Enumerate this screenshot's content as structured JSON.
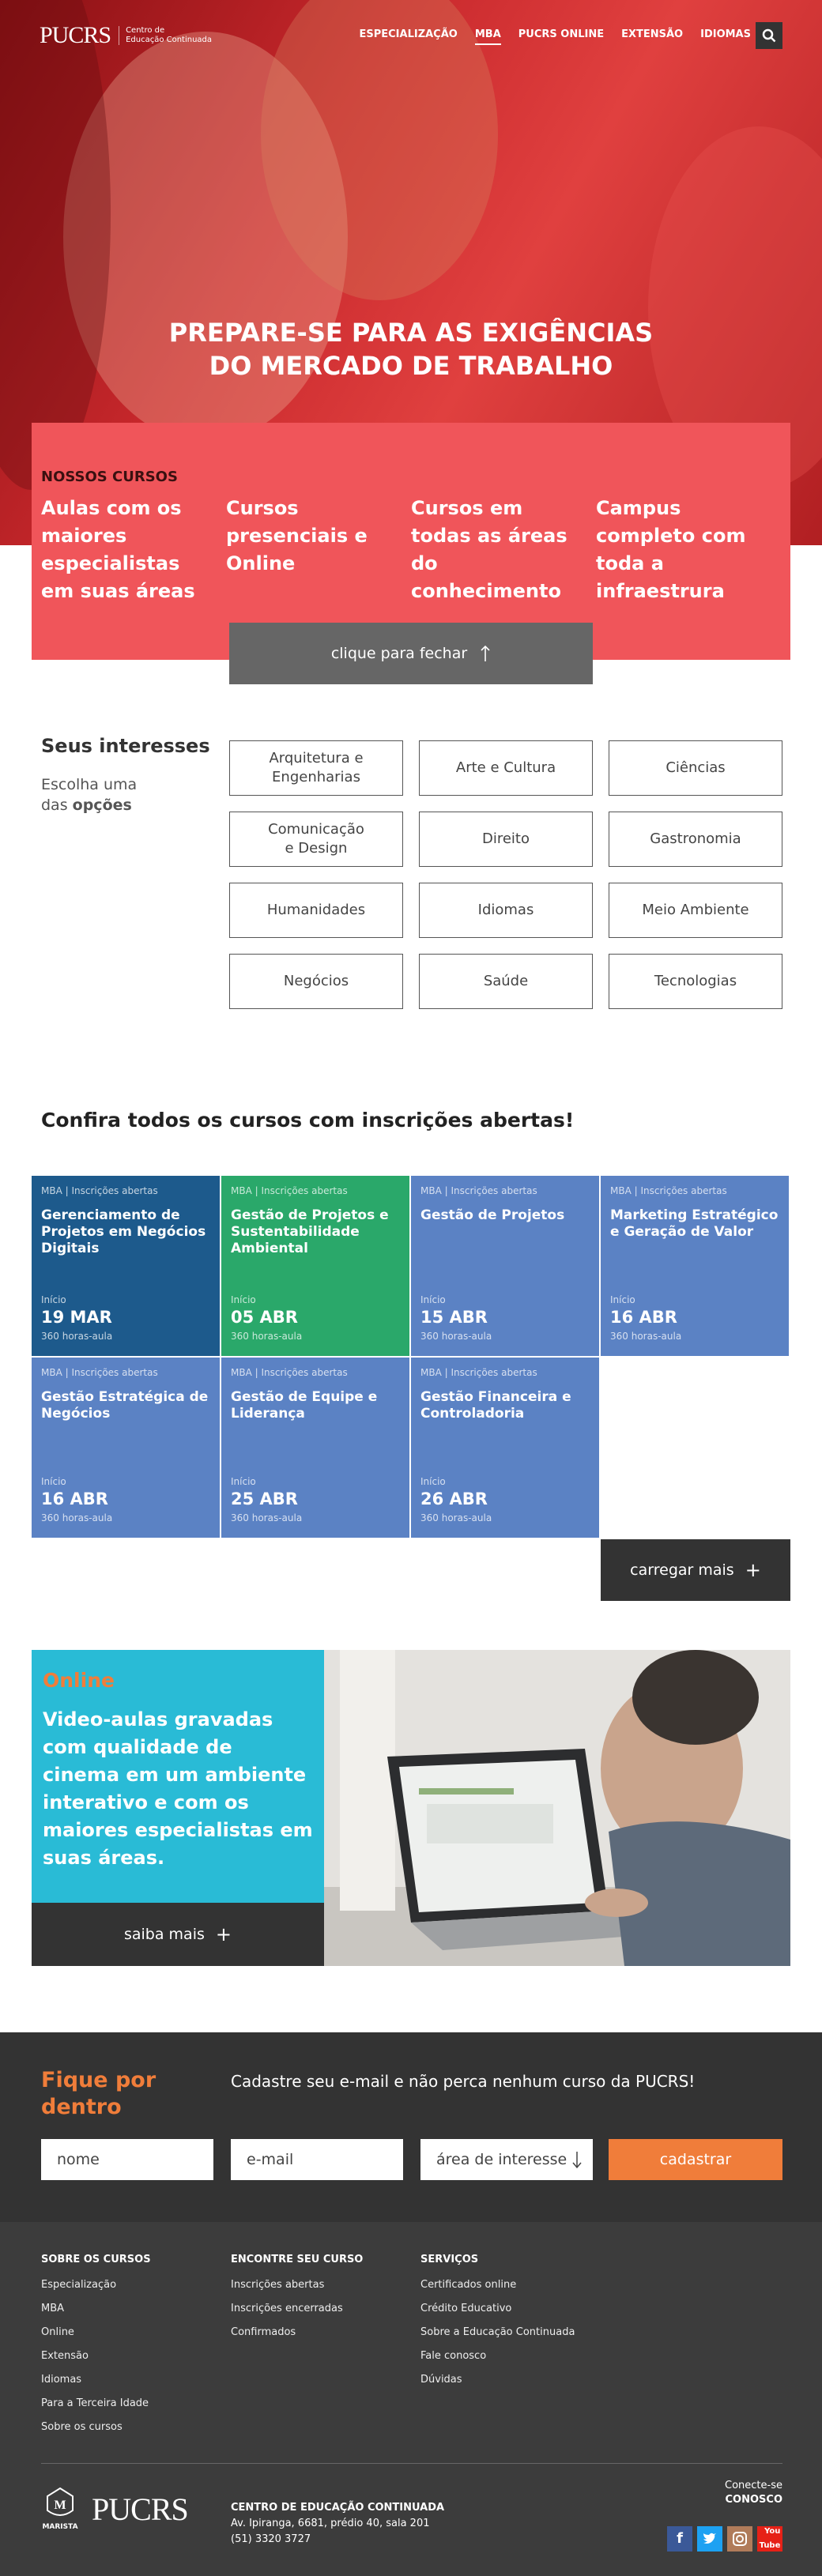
{
  "header": {
    "brand": "PUCRS",
    "brand_sub": "Centro de\nEducação Continuada",
    "nav": [
      "ESPECIALIZAÇÃO",
      "MBA",
      "PUCRS ONLINE",
      "EXTENSÃO",
      "IDIOMAS"
    ],
    "active_nav": "MBA"
  },
  "hero": {
    "line1": "PREPARE-SE PARA AS EXIGÊNCIAS",
    "line2": "DO MERCADO DE TRABALHO"
  },
  "courses_info": {
    "heading": "NOSSOS CURSOS",
    "items": [
      "Aulas com os maiores especialistas em suas áreas",
      "Cursos presenciais e Online",
      "Cursos em todas as áreas do conhecimento",
      "Campus completo com toda a infraestrura"
    ],
    "close_label": "clique para fechar"
  },
  "interests": {
    "title": "Seus interesses",
    "sub1": "Escolha uma",
    "sub2": "das",
    "sub3": "opções",
    "options": [
      "Arquitetura e Engenharias",
      "Arte e Cultura",
      "Ciências",
      "Comunicação e Design",
      "Direito",
      "Gastronomia",
      "Humanidades",
      "Idiomas",
      "Meio Ambiente",
      "Negócios",
      "Saúde",
      "Tecnologias"
    ]
  },
  "open_courses": {
    "title": "Confira todos os cursos com inscrições abertas!",
    "start_label": "Início",
    "cards": [
      {
        "tag": "MBA | Inscrições abertas",
        "name": "Gerenciamento de Projetos em Negócios Digitais",
        "date": "19 MAR",
        "hours": "360 horas-aula",
        "color": "#1d5a8c"
      },
      {
        "tag": "MBA | Inscrições abertas",
        "name": "Gestão de Projetos e Sustentabilidade Ambiental",
        "date": "05 ABR",
        "hours": "360 horas-aula",
        "color": "#2aa86a"
      },
      {
        "tag": "MBA | Inscrições abertas",
        "name": "Gestão de Projetos",
        "date": "15 ABR",
        "hours": "360 horas-aula",
        "color": "#5b82c4"
      },
      {
        "tag": "MBA | Inscrições abertas",
        "name": "Marketing Estratégico e Geração de Valor",
        "date": "16 ABR",
        "hours": "360 horas-aula",
        "color": "#5b82c4"
      },
      {
        "tag": "MBA | Inscrições abertas",
        "name": "Gestão Estratégica de Negócios",
        "date": "16 ABR",
        "hours": "360 horas-aula",
        "color": "#5b82c4"
      },
      {
        "tag": "MBA | Inscrições abertas",
        "name": "Gestão de Equipe e Liderança",
        "date": "25 ABR",
        "hours": "360 horas-aula",
        "color": "#5b82c4"
      },
      {
        "tag": "MBA | Inscrições abertas",
        "name": "Gestão Financeira e Controladoria",
        "date": "26 ABR",
        "hours": "360 horas-aula",
        "color": "#5b82c4"
      }
    ],
    "load_more": "carregar mais"
  },
  "online": {
    "heading": "Online",
    "text": "Video-aulas gravadas com qualidade de cinema em um ambiente interativo e com os maiores especialistas em suas áreas.",
    "button": "saiba mais"
  },
  "newsletter": {
    "title": "Fique por dentro",
    "text": "Cadastre seu e-mail e não perca nenhum curso da PUCRS!",
    "name_placeholder": "nome",
    "email_placeholder": "e-mail",
    "interest_placeholder": "área de interesse",
    "submit": "cadastrar"
  },
  "footer": {
    "col1": {
      "title": "SOBRE OS CURSOS",
      "links": [
        "Especialização",
        "MBA",
        "Online",
        "Extensão",
        "Idiomas",
        "Para a Terceira Idade",
        "Sobre os cursos"
      ]
    },
    "col2": {
      "title": "ENCONTRE SEU CURSO",
      "links": [
        "Inscrições abertas",
        "Inscrições encerradas",
        "Confirmados"
      ]
    },
    "col3": {
      "title": "SERVIÇOS",
      "links": [
        "Certificados online",
        "Crédito Educativo",
        "Sobre a Educação Continuada",
        "Fale conosco",
        "Dúvidas"
      ]
    },
    "marista": "MARISTA",
    "brand": "PUCRS",
    "org": "CENTRO DE EDUCAÇÃO CONTINUADA",
    "address": "Av. Ipiranga, 6681, prédio 40, sala 201",
    "phone": "(51) 3320 3727",
    "connect": "Conecte-se",
    "connect_bold": "CONOSCO"
  },
  "colors": {
    "primary_red": "#f0555a",
    "accent_orange": "#f07d3a",
    "cyan": "#29bbd6",
    "dark": "#333333"
  }
}
